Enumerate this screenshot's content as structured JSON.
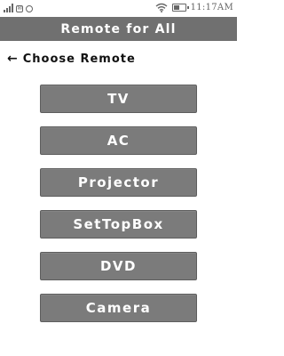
{
  "status_bar": {
    "time": "11:17AM",
    "signal_icon": "signal-bars-icon",
    "notification_icon": "notification-icon",
    "whatsapp_icon": "whatsapp-icon",
    "wifi_icon": "wifi-icon",
    "battery_icon": "battery-icon",
    "battery_level": 0.55
  },
  "app_bar": {
    "title": "Remote for All"
  },
  "header": {
    "back_icon": "back-arrow-icon",
    "back_glyph": "←",
    "title": "Choose Remote"
  },
  "remotes": [
    {
      "label": "TV"
    },
    {
      "label": "AC"
    },
    {
      "label": "Projector"
    },
    {
      "label": "SetTopBox"
    },
    {
      "label": "DVD"
    },
    {
      "label": "Camera"
    }
  ]
}
